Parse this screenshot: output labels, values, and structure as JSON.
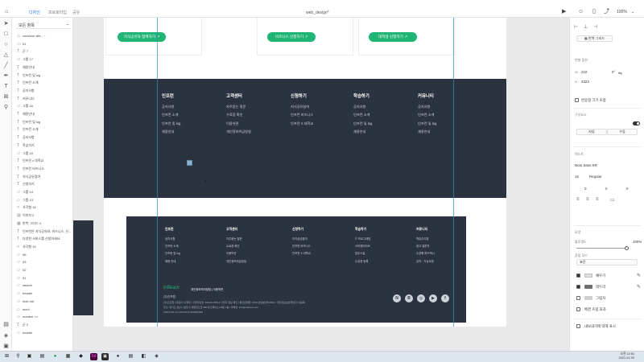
{
  "titlebar": {
    "tabs": [
      "디자인",
      "프로토타입",
      "공유"
    ],
    "doc_title": "web_design*",
    "zoom": "100%"
  },
  "layers": {
    "page": "모든 항목",
    "items": [
      {
        "label": "common site - ~",
        "icon": "component-icon"
      },
      {
        "label": "01",
        "icon": "artboard-icon"
      },
      {
        "label": "군 7",
        "icon": "text-icon"
      },
      {
        "label": "그룹 17",
        "icon": "folder-icon"
      },
      {
        "label": "채용안내",
        "icon": "text-icon"
      },
      {
        "label": "인프런 및 log",
        "icon": "text-icon"
      },
      {
        "label": "인프런 소개",
        "icon": "text-icon"
      },
      {
        "label": "공지사항",
        "icon": "text-icon"
      },
      {
        "label": "커뮤니티",
        "icon": "text-icon"
      },
      {
        "label": "그룹 16",
        "icon": "folder-icon"
      },
      {
        "label": "채용안내",
        "icon": "text-icon"
      },
      {
        "label": "인프런 및 log",
        "icon": "text-icon"
      },
      {
        "label": "인프런 소개",
        "icon": "text-icon"
      },
      {
        "label": "공지사항",
        "icon": "text-icon"
      },
      {
        "label": "학습하기",
        "icon": "text-icon"
      },
      {
        "label": "그룹 15",
        "icon": "folder-icon"
      },
      {
        "label": "인프런 x 대학교",
        "icon": "text-icon"
      },
      {
        "label": "인프런 비즈니스",
        "icon": "text-icon"
      },
      {
        "label": "지식공유참여",
        "icon": "text-icon"
      },
      {
        "label": "신청하기",
        "icon": "text-icon"
      },
      {
        "label": "그룹 14",
        "icon": "folder-icon"
      },
      {
        "label": "그룹 13",
        "icon": "folder-icon"
      },
      {
        "label": "사각형 16",
        "icon": "rect-icon"
      },
      {
        "label": "이미지 2",
        "icon": "image-icon"
      },
      {
        "label": "반복 그리드 4",
        "icon": "grid-icon"
      },
      {
        "label": "인프런은 지식공유와, 비즈니스, 신...",
        "icon": "text-icon"
      },
      {
        "label": "다양한 서비스를 신청하세요.",
        "icon": "text-icon"
      },
      {
        "label": "사각형 19",
        "icon": "rect-icon"
      },
      {
        "label": "06",
        "icon": "folder-icon"
      },
      {
        "label": "03",
        "icon": "folder-icon"
      },
      {
        "label": "02",
        "icon": "folder-icon"
      },
      {
        "label": "01",
        "icon": "folder-icon"
      },
      {
        "label": "search",
        "icon": "folder-icon"
      },
      {
        "label": "header",
        "icon": "folder-icon"
      },
      {
        "label": "hide nut",
        "icon": "folder-icon"
      },
      {
        "label": "word",
        "icon": "folder-icon"
      },
      {
        "label": "number >>",
        "icon": "folder-icon"
      },
      {
        "label": "군 2",
        "icon": "text-icon"
      },
      {
        "label": "header",
        "icon": "folder-icon"
      }
    ]
  },
  "canvas": {
    "cta_buttons": [
      "지식공유자 참여하기",
      "비즈니스 신청하기",
      "대학생 신청하기"
    ],
    "footer_columns": [
      {
        "title": "인프런",
        "items": [
          "공지사항",
          "인프런 소개",
          "인프런 및 log",
          "채용안내"
        ]
      },
      {
        "title": "고객센터",
        "items": [
          "자주묻는 질문",
          "수료증 확인",
          "이용약관",
          "개인정보취급방침"
        ]
      },
      {
        "title": "신청하기",
        "items": [
          "지식공유참여",
          "인프런 비즈니스",
          "인프런 X 대학교"
        ]
      },
      {
        "title": "학습하기",
        "items": [
          "공지사항",
          "인프런 소개",
          "인프런 및 log",
          "채용안내"
        ]
      },
      {
        "title": "커뮤니티",
        "items": [
          "공지사항",
          "인프런 소개",
          "인프런 및 log",
          "채용안내"
        ]
      }
    ],
    "footer_small_columns": [
      {
        "title": "인프런",
        "items": [
          "공지사항",
          "인프런 소개",
          "인프런 및 log",
          "채용 안내"
        ]
      },
      {
        "title": "고객센터",
        "items": [
          "자주묻는 질문",
          "수료증 확인",
          "이용약관",
          "개인정보취급방침"
        ]
      },
      {
        "title": "신청하기",
        "items": [
          "지식공유참여",
          "인프런 비즈니스",
          "인프런 X 대학교"
        ]
      },
      {
        "title": "학습하기",
        "items": [
          "IT 프로그래밍",
          "크리에이티브",
          "업무스킬",
          "수강권 등록"
        ]
      },
      {
        "title": "커뮤니티",
        "items": [
          "학습주리뷰",
          "광고 질문지",
          "수강평 피드백시",
          "강의 · 기능요청"
        ]
      }
    ],
    "footer_brand": "inflearn",
    "footer_links": [
      "개인정보처리방침",
      "이용약관"
    ],
    "footer_company": "(주)인프랩",
    "footer_info": [
      "(주)인프랩 | 대표자: 이형주 | 사업자번호: 499-81-00612 사업자 정보 확인 | 통신판매업: 2018-성남분당B-0062 | 개인정보보호책임자: 이동욱",
      "주소: 경기도 성남시 분당구 대왕판교로 660 유스페이스1 B동 4층 | 이메일: info@inflearn.com",
      "©INFLAB. ALL RIGHTS RESERVED"
    ],
    "sns": [
      "N",
      "B",
      "◎",
      "▶",
      "f"
    ]
  },
  "props": {
    "header_icon_label": "반복 그리드",
    "section_transform": "변형 옵션",
    "w_label": "W",
    "w_value": "1",
    "h_label": "H",
    "h_value": "2",
    "x_label": "X",
    "x_value": "210",
    "y_label": "Y",
    "y_value": "3323",
    "rot_value": "0°",
    "responsive_label": "반응형 크기 조정",
    "component_label": "구성요소",
    "states": [
      "자동",
      "수동"
    ],
    "text_label": "텍스트",
    "font": "Noto Sans KR",
    "font_size": "16",
    "font_weight": "Regular",
    "tracking": "0",
    "line": "0",
    "spacing": "0",
    "appearance_label": "모양",
    "opacity_label": "불투명도",
    "opacity_value": "100%",
    "blend_label": "혼합 모드",
    "blend_value": "표준",
    "fill_label": "채우기",
    "border_label": "테두리",
    "shadow_label": "그림자",
    "bg_blur_label": "배경 흐림 효과",
    "export_label": "내보내기에 대해 표시",
    "fill_color": "#e0e0e0",
    "border_color": "#707070"
  },
  "taskbar": {
    "time": "오전 12:51",
    "date": "2021-01-09"
  },
  "colors": {
    "accent": "#1473e6",
    "cta_green": "#20b575",
    "footer_bg": "#2c3340"
  }
}
